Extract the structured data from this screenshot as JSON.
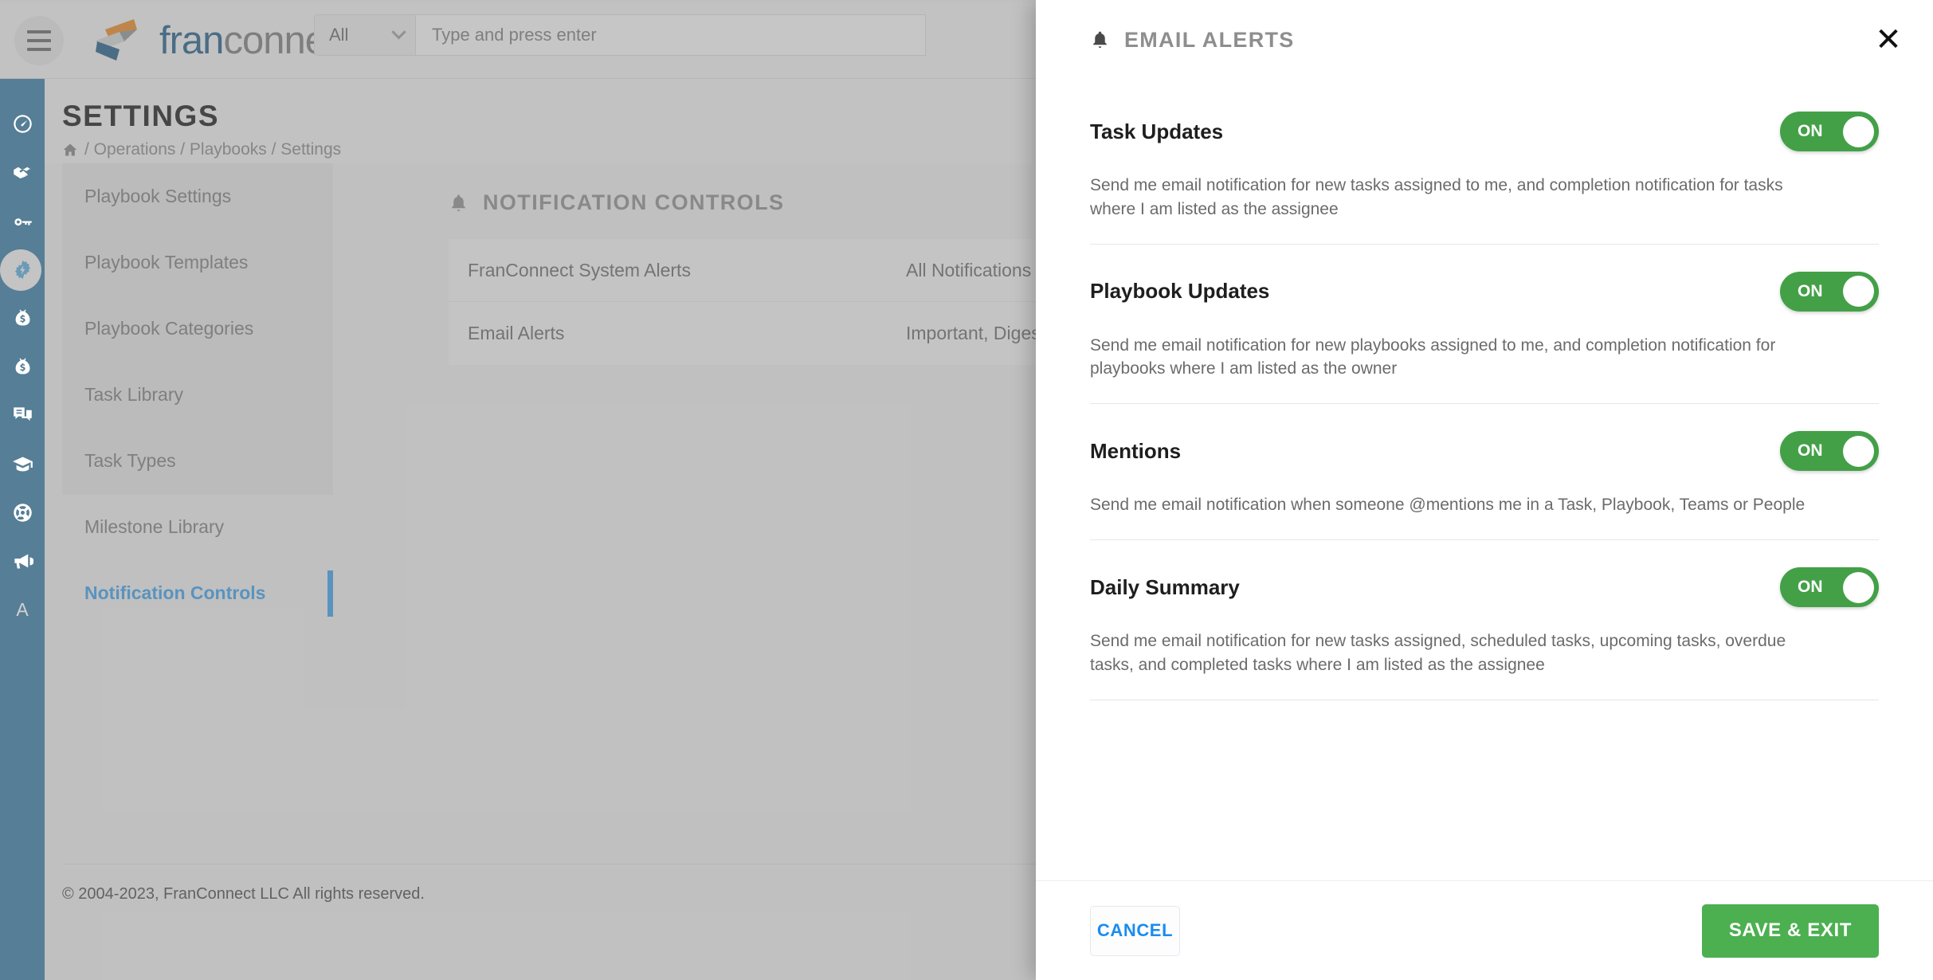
{
  "topbar": {
    "menu_icon": "hamburger-icon",
    "logo_text_1": "fran",
    "logo_text_2": "connect",
    "search_scope_value": "All",
    "search_placeholder": "Type and press enter"
  },
  "rail": {
    "items": [
      {
        "icon": "dashboard-gauge-icon",
        "name": "dashboard"
      },
      {
        "icon": "handshake-icon",
        "name": "crm"
      },
      {
        "icon": "key-icon",
        "name": "opener"
      },
      {
        "icon": "gear-bolt-icon",
        "name": "operations",
        "active": true
      },
      {
        "icon": "money-bag-icon",
        "name": "financials"
      },
      {
        "icon": "money-bag-icon",
        "name": "royalties"
      },
      {
        "icon": "chat-bubbles-icon",
        "name": "hub"
      },
      {
        "icon": "graduation-cap-icon",
        "name": "learning"
      },
      {
        "icon": "life-ring-icon",
        "name": "support"
      },
      {
        "icon": "megaphone-icon",
        "name": "marketing"
      }
    ],
    "bottom_letter": "A"
  },
  "page": {
    "title": "SETTINGS",
    "breadcrumb": "/ Operations / Playbooks / Settings",
    "home_icon": "home-icon"
  },
  "settings_nav": {
    "items": [
      {
        "label": "Playbook Settings",
        "active": false
      },
      {
        "label": "Playbook Templates",
        "active": false
      },
      {
        "label": "Playbook Categories",
        "active": false
      },
      {
        "label": "Task Library",
        "active": false
      },
      {
        "label": "Task Types",
        "active": false
      },
      {
        "label": "Milestone Library",
        "active": false
      },
      {
        "label": "Notification Controls",
        "active": true
      }
    ]
  },
  "notification_controls": {
    "icon": "bell-icon",
    "title": "NOTIFICATION CONTROLS",
    "rows": [
      {
        "label": "FranConnect System Alerts",
        "value": "All Notifications"
      },
      {
        "label": "Email Alerts",
        "value": "Important, Digest"
      }
    ]
  },
  "footer": {
    "copyright": "© 2004-2023, FranConnect LLC All rights reserved."
  },
  "modal": {
    "icon": "bell-icon",
    "title": "EMAIL ALERTS",
    "close_icon": "close-icon",
    "alerts": [
      {
        "name": "Task Updates",
        "toggle_label": "ON",
        "description": "Send me email notification for new tasks assigned to me, and completion notification for tasks where I am listed as the assignee"
      },
      {
        "name": "Playbook Updates",
        "toggle_label": "ON",
        "description": "Send me email notification for new playbooks assigned to me, and completion notification for playbooks where I am listed as the owner"
      },
      {
        "name": "Mentions",
        "toggle_label": "ON",
        "description": "Send me email notification when someone @mentions me in a Task, Playbook, Teams or People"
      },
      {
        "name": "Daily Summary",
        "toggle_label": "ON",
        "description": "Send me email notification for new tasks assigned, scheduled tasks, upcoming tasks, overdue tasks, and completed tasks where I am listed as the assignee"
      }
    ],
    "cancel_label": "CANCEL",
    "save_label": "SAVE & EXIT"
  },
  "colors": {
    "rail_blue": "#6a9ab8",
    "accent_blue": "#6db4e8",
    "toggle_green": "#43a047",
    "save_green": "#4caf50",
    "cancel_blue": "#1a8cf0",
    "logo_orange": "#e8a council"
  }
}
